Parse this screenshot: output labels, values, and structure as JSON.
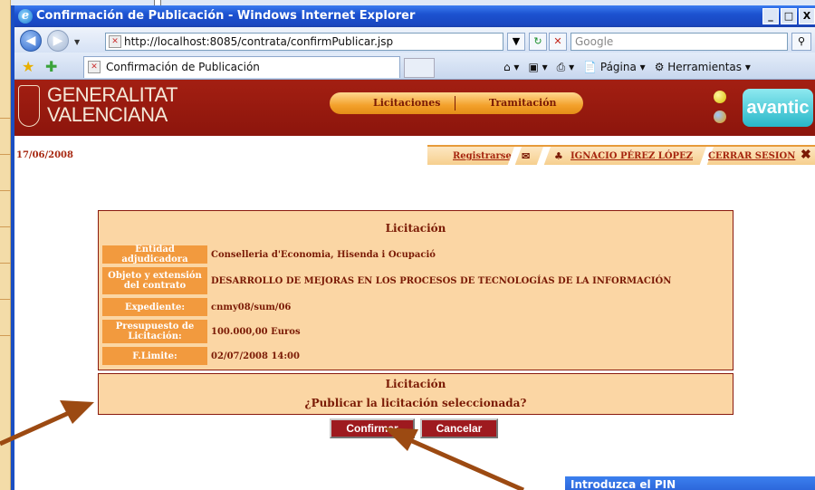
{
  "window": {
    "title": "Confirmación de Publicación - Windows Internet Explorer",
    "controls": [
      "_",
      "□",
      "X"
    ]
  },
  "addressbar": {
    "url": "http://localhost:8085/contrata/confirmPublicar.jsp",
    "search_placeholder": "Google"
  },
  "tabbar": {
    "tab_title": "Confirmación de Publicación",
    "pagina_label": "Página",
    "herramientas_label": "Herramientas"
  },
  "banner": {
    "logo_line1": "GENERALITAT",
    "logo_line2": "VALENCIANA",
    "menu": [
      "Licitaciones",
      "Tramitación"
    ],
    "avantic_logo": "avantic"
  },
  "userbar": {
    "date": "17/06/2008",
    "register": "Registrarse",
    "user_name": "IGNACIO PÉREZ LÓPEZ",
    "logout": "CERRAR SESION"
  },
  "licitacion": {
    "title": "Licitación",
    "rows": [
      {
        "label": "Entidad adjudicadora",
        "value": "Conselleria d'Economia, Hisenda i Ocupació"
      },
      {
        "label": "Objeto y extensión del contrato",
        "value": "DESARROLLO DE MEJORAS EN LOS PROCESOS DE TECNOLOGÍAS DE LA INFORMACIÓN"
      },
      {
        "label": "Expediente:",
        "value": "cnmy08/sum/06"
      },
      {
        "label": "Presupuesto de Licitación:",
        "value": "100.000,00 Euros"
      },
      {
        "label": "F.Limite:",
        "value": "02/07/2008 14:00"
      }
    ]
  },
  "confirm_panel": {
    "title": "Licitación",
    "question": "¿Publicar la licitación seleccionada?"
  },
  "buttons": {
    "confirm": "Confirmar",
    "cancel": "Cancelar"
  },
  "pin_dialog": {
    "title": "Introduzca el PIN"
  },
  "colors": {
    "banner": "#a31f12",
    "panel_bg": "#fbd6a4",
    "label_bg": "#f29a3e",
    "text_dark_red": "#7a1a05",
    "button_bg": "#9e1a1f",
    "arrow": "#9c4a12"
  }
}
